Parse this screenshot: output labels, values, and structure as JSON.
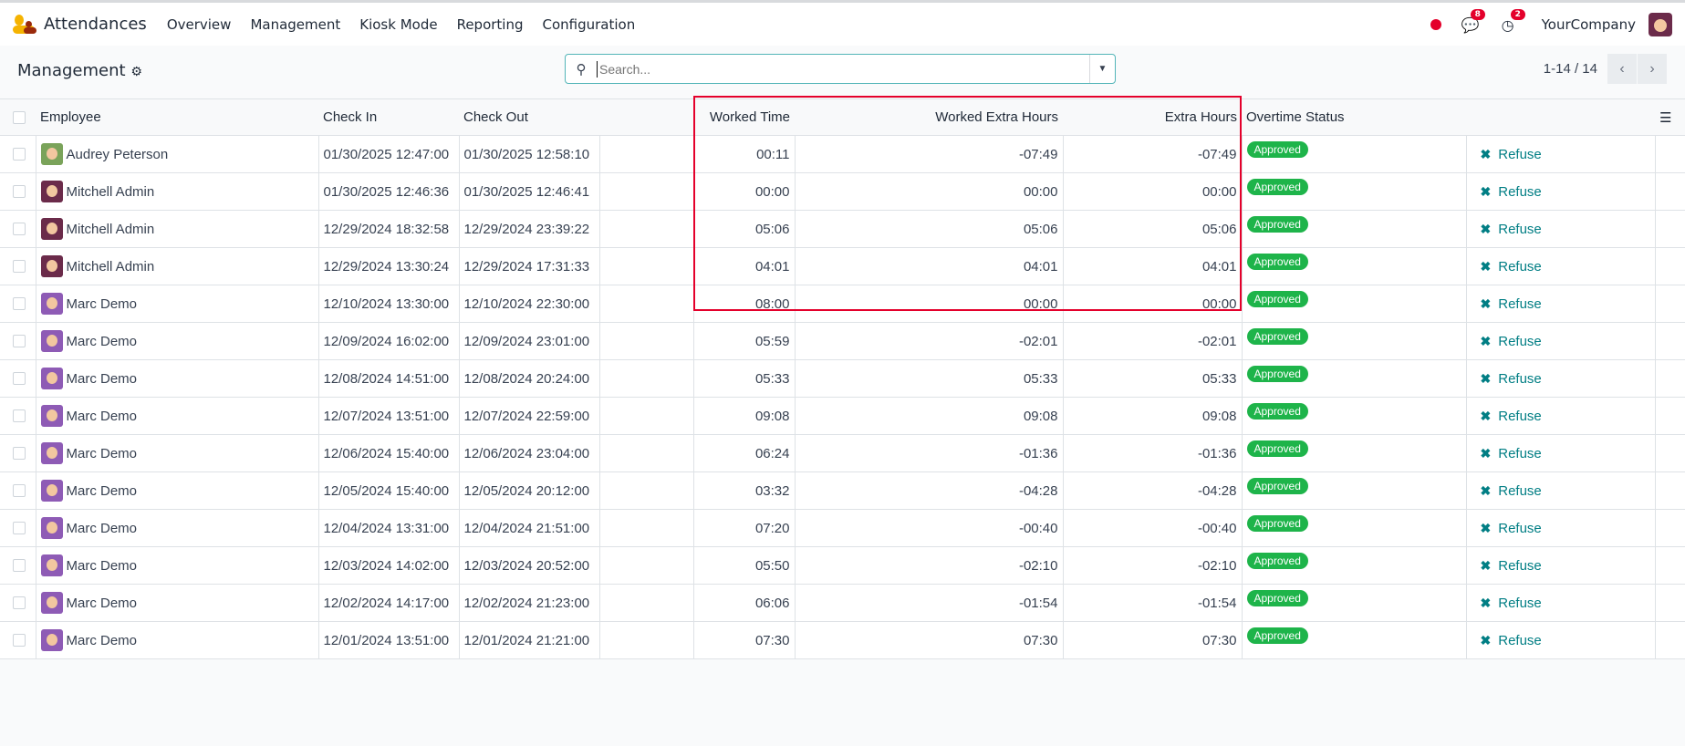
{
  "nav": {
    "app": "Attendances",
    "menu": [
      "Overview",
      "Management",
      "Kiosk Mode",
      "Reporting",
      "Configuration"
    ],
    "messages_count": "8",
    "activities_count": "2",
    "company": "YourCompany"
  },
  "control": {
    "title": "Management",
    "search_placeholder": "Search...",
    "pager": "1-14 / 14"
  },
  "columns": {
    "employee": "Employee",
    "check_in": "Check In",
    "check_out": "Check Out",
    "worked_time": "Worked Time",
    "worked_extra": "Worked Extra Hours",
    "extra_hours": "Extra Hours",
    "overtime_status": "Overtime Status"
  },
  "refuse_label": "Refuse",
  "rows": [
    {
      "employee": "Audrey Peterson",
      "avatar": "#7aa35a",
      "check_in": "01/30/2025 12:47:00",
      "check_out": "01/30/2025 12:58:10",
      "worked": "00:11",
      "worked_extra": "-07:49",
      "extra": "-07:49",
      "status": "Approved"
    },
    {
      "employee": "Mitchell Admin",
      "avatar": "#6b2b4a",
      "check_in": "01/30/2025 12:46:36",
      "check_out": "01/30/2025 12:46:41",
      "worked": "00:00",
      "worked_extra": "00:00",
      "extra": "00:00",
      "status": "Approved"
    },
    {
      "employee": "Mitchell Admin",
      "avatar": "#6b2b4a",
      "check_in": "12/29/2024 18:32:58",
      "check_out": "12/29/2024 23:39:22",
      "worked": "05:06",
      "worked_extra": "05:06",
      "extra": "05:06",
      "status": "Approved"
    },
    {
      "employee": "Mitchell Admin",
      "avatar": "#6b2b4a",
      "check_in": "12/29/2024 13:30:24",
      "check_out": "12/29/2024 17:31:33",
      "worked": "04:01",
      "worked_extra": "04:01",
      "extra": "04:01",
      "status": "Approved"
    },
    {
      "employee": "Marc Demo",
      "avatar": "#8e5bb5",
      "check_in": "12/10/2024 13:30:00",
      "check_out": "12/10/2024 22:30:00",
      "worked": "08:00",
      "worked_extra": "00:00",
      "extra": "00:00",
      "status": "Approved"
    },
    {
      "employee": "Marc Demo",
      "avatar": "#8e5bb5",
      "check_in": "12/09/2024 16:02:00",
      "check_out": "12/09/2024 23:01:00",
      "worked": "05:59",
      "worked_extra": "-02:01",
      "extra": "-02:01",
      "status": "Approved"
    },
    {
      "employee": "Marc Demo",
      "avatar": "#8e5bb5",
      "check_in": "12/08/2024 14:51:00",
      "check_out": "12/08/2024 20:24:00",
      "worked": "05:33",
      "worked_extra": "05:33",
      "extra": "05:33",
      "status": "Approved"
    },
    {
      "employee": "Marc Demo",
      "avatar": "#8e5bb5",
      "check_in": "12/07/2024 13:51:00",
      "check_out": "12/07/2024 22:59:00",
      "worked": "09:08",
      "worked_extra": "09:08",
      "extra": "09:08",
      "status": "Approved"
    },
    {
      "employee": "Marc Demo",
      "avatar": "#8e5bb5",
      "check_in": "12/06/2024 15:40:00",
      "check_out": "12/06/2024 23:04:00",
      "worked": "06:24",
      "worked_extra": "-01:36",
      "extra": "-01:36",
      "status": "Approved"
    },
    {
      "employee": "Marc Demo",
      "avatar": "#8e5bb5",
      "check_in": "12/05/2024 15:40:00",
      "check_out": "12/05/2024 20:12:00",
      "worked": "03:32",
      "worked_extra": "-04:28",
      "extra": "-04:28",
      "status": "Approved"
    },
    {
      "employee": "Marc Demo",
      "avatar": "#8e5bb5",
      "check_in": "12/04/2024 13:31:00",
      "check_out": "12/04/2024 21:51:00",
      "worked": "07:20",
      "worked_extra": "-00:40",
      "extra": "-00:40",
      "status": "Approved"
    },
    {
      "employee": "Marc Demo",
      "avatar": "#8e5bb5",
      "check_in": "12/03/2024 14:02:00",
      "check_out": "12/03/2024 20:52:00",
      "worked": "05:50",
      "worked_extra": "-02:10",
      "extra": "-02:10",
      "status": "Approved"
    },
    {
      "employee": "Marc Demo",
      "avatar": "#8e5bb5",
      "check_in": "12/02/2024 14:17:00",
      "check_out": "12/02/2024 21:23:00",
      "worked": "06:06",
      "worked_extra": "-01:54",
      "extra": "-01:54",
      "status": "Approved"
    },
    {
      "employee": "Marc Demo",
      "avatar": "#8e5bb5",
      "check_in": "12/01/2024 13:51:00",
      "check_out": "12/01/2024 21:21:00",
      "worked": "07:30",
      "worked_extra": "07:30",
      "extra": "07:30",
      "status": "Approved"
    }
  ]
}
